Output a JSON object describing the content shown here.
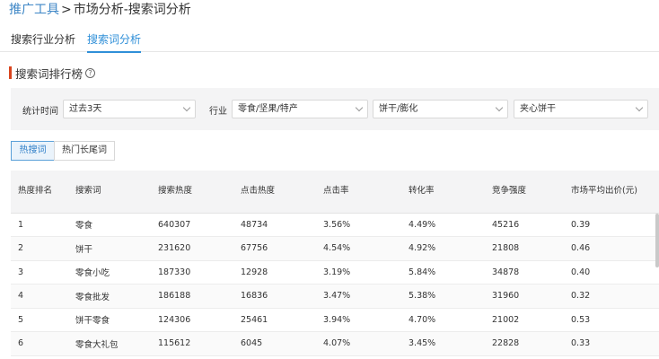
{
  "breadcrumb": {
    "root": "推广工具",
    "sep": ">",
    "current": "市场分析-搜索词分析"
  },
  "tabs": [
    {
      "label": "搜索行业分析",
      "active": false
    },
    {
      "label": "搜索词分析",
      "active": true
    }
  ],
  "section": {
    "title": "搜索词排行榜",
    "help_icon": "question-circle"
  },
  "filters": {
    "period_label": "统计时间",
    "period_value": "过去3天",
    "industry_label": "行业",
    "industry_level1": "零食/坚果/特产",
    "industry_level2": "饼干/膨化",
    "industry_level3": "夹心饼干"
  },
  "toggle": [
    {
      "label": "热搜词",
      "active": true
    },
    {
      "label": "热门长尾词",
      "active": false
    }
  ],
  "table": {
    "headers": [
      "热度排名",
      "搜索词",
      "搜索热度",
      "点击热度",
      "点击率",
      "转化率",
      "竞争强度",
      "市场平均出价(元)"
    ],
    "rows": [
      [
        "1",
        "零食",
        "640307",
        "48734",
        "3.56%",
        "4.49%",
        "45216",
        "0.39"
      ],
      [
        "2",
        "饼干",
        "231620",
        "67756",
        "4.54%",
        "4.92%",
        "21808",
        "0.46"
      ],
      [
        "3",
        "零食小吃",
        "187330",
        "12928",
        "3.19%",
        "5.84%",
        "34878",
        "0.40"
      ],
      [
        "4",
        "零食批发",
        "186188",
        "16836",
        "3.47%",
        "5.38%",
        "31960",
        "0.32"
      ],
      [
        "5",
        "饼干零食",
        "124306",
        "25461",
        "3.94%",
        "4.70%",
        "21002",
        "0.53"
      ],
      [
        "6",
        "零食大礼包",
        "115612",
        "6045",
        "4.07%",
        "3.45%",
        "22828",
        "0.33"
      ]
    ]
  },
  "colors": {
    "accent": "#2f8fd8",
    "section_bar": "#d9441e",
    "panel_bg": "#f4f4f5"
  }
}
